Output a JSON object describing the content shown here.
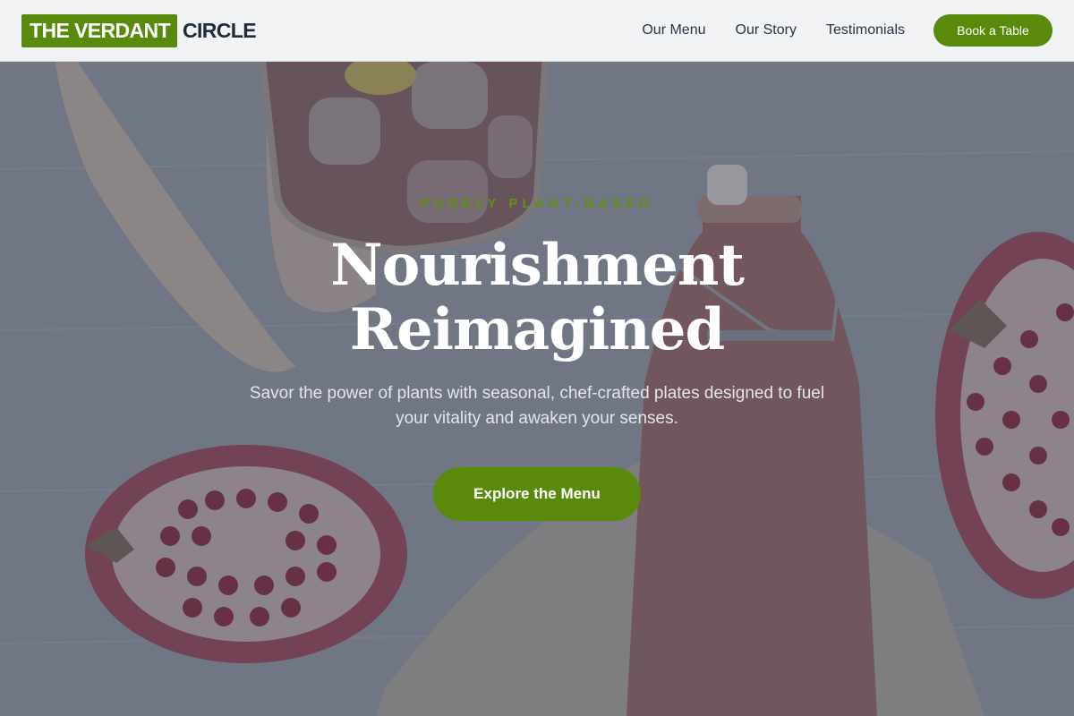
{
  "header": {
    "logo_highlight": "THE VERDANT",
    "logo_rest": "CIRCLE",
    "nav": [
      {
        "label": "Our Menu"
      },
      {
        "label": "Our Story"
      },
      {
        "label": "Testimonials"
      }
    ],
    "cta_label": "Book a Table"
  },
  "hero": {
    "eyebrow": "PURELY PLANT-BASED",
    "headline_line1": "Nourishment",
    "headline_line2": "Reimagined",
    "subtext": "Savor the power of plants with seasonal, chef-crafted plates designed to fuel your vitality and awaken your senses.",
    "button_label": "Explore the Menu"
  },
  "colors": {
    "brand_green": "#5a8a0c",
    "header_bg": "#f1f2f4",
    "headline_text": "#ffffff",
    "eyebrow_text": "#5f9016"
  },
  "icons": [
    "glass-icon",
    "bottle-icon",
    "pomegranate-icon"
  ]
}
